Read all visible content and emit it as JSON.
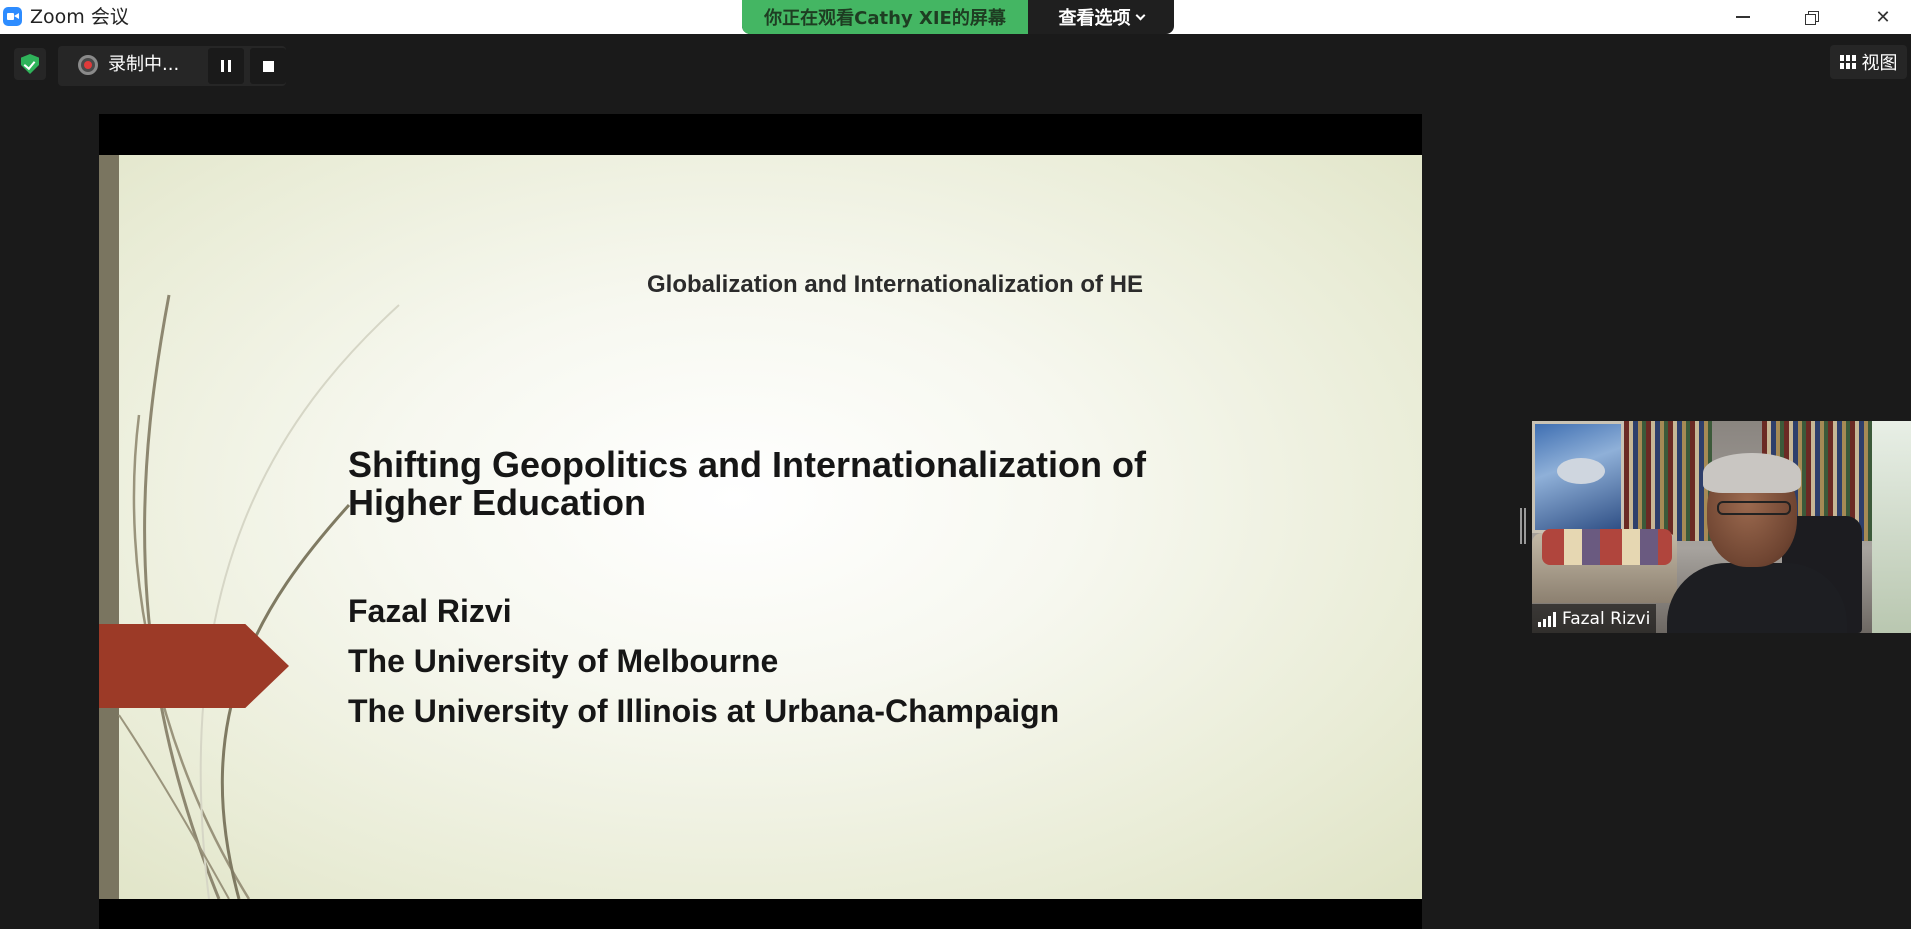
{
  "window": {
    "title": "Zoom 会议"
  },
  "share_banner": {
    "viewing_text": "你正在观看Cathy XIE的屏幕",
    "options_label": "查看选项"
  },
  "toolbar": {
    "recording_label": "录制中...",
    "view_label": "视图"
  },
  "slide": {
    "header": "Globalization and Internationalization of HE",
    "title_line1": "Shifting Geopolitics and Internationalization of",
    "title_line2": "Higher Education",
    "presenter_name": "Fazal Rizvi",
    "affiliation_1": "The University of Melbourne",
    "affiliation_2": "The University of Illinois at Urbana-Champaign",
    "accent_color": "#9c3a27"
  },
  "participant": {
    "name": "Fazal Rizvi"
  },
  "colors": {
    "share_green": "#44b663",
    "security_green": "#2fb35a",
    "zoom_blue": "#2d8cff",
    "background": "#1a1a1a"
  }
}
